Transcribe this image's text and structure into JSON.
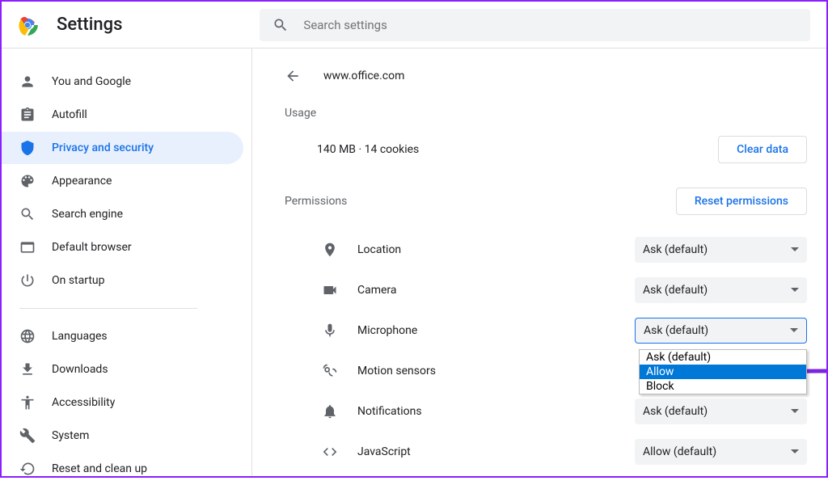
{
  "header": {
    "title": "Settings",
    "searchPlaceholder": "Search settings"
  },
  "sidebar": {
    "items": [
      {
        "label": "You and Google"
      },
      {
        "label": "Autofill"
      },
      {
        "label": "Privacy and security"
      },
      {
        "label": "Appearance"
      },
      {
        "label": "Search engine"
      },
      {
        "label": "Default browser"
      },
      {
        "label": "On startup"
      }
    ],
    "items2": [
      {
        "label": "Languages"
      },
      {
        "label": "Downloads"
      },
      {
        "label": "Accessibility"
      },
      {
        "label": "System"
      },
      {
        "label": "Reset and clean up"
      }
    ]
  },
  "content": {
    "siteUrl": "www.office.com",
    "usageLabel": "Usage",
    "usageText": "140 MB · 14 cookies",
    "clearButton": "Clear data",
    "permissionsLabel": "Permissions",
    "resetButton": "Reset permissions",
    "permissions": [
      {
        "label": "Location",
        "value": "Ask (default)"
      },
      {
        "label": "Camera",
        "value": "Ask (default)"
      },
      {
        "label": "Microphone",
        "value": "Ask (default)"
      },
      {
        "label": "Motion sensors",
        "value": ""
      },
      {
        "label": "Notifications",
        "value": "Ask (default)"
      },
      {
        "label": "JavaScript",
        "value": "Allow (default)"
      }
    ],
    "dropdownOptions": [
      "Ask (default)",
      "Allow",
      "Block"
    ]
  }
}
